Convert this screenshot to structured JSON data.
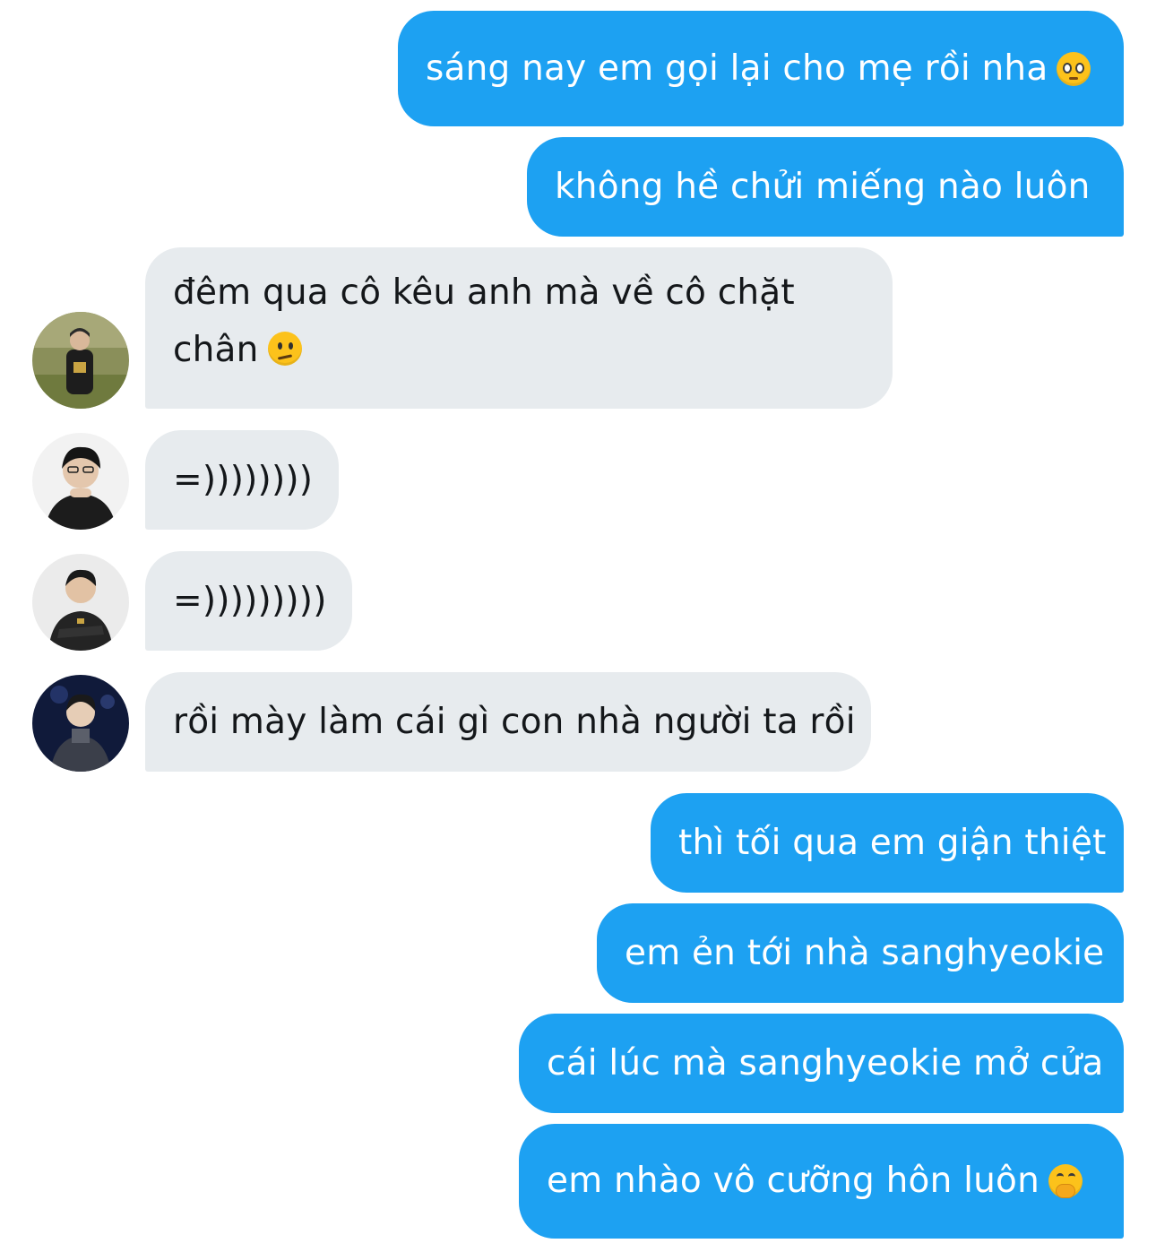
{
  "conversation": {
    "messages": [
      {
        "direction": "outgoing",
        "text": "sáng nay em gọi lại cho mẹ rồi nha",
        "emoji": "pleading-face-emoji"
      },
      {
        "direction": "outgoing",
        "text": "không hề chửi miếng nào luôn"
      },
      {
        "direction": "incoming",
        "text": "đêm qua cô kêu anh mà về cô chặt chân",
        "emoji": "confused-face-emoji",
        "avatar": "avatar-user-1"
      },
      {
        "direction": "incoming",
        "text": "=))))))))",
        "avatar": "avatar-user-2"
      },
      {
        "direction": "incoming",
        "text": "=)))))))))",
        "avatar": "avatar-user-3"
      },
      {
        "direction": "incoming",
        "text": "rồi mày làm cái gì con nhà người ta rồi",
        "avatar": "avatar-user-4"
      },
      {
        "direction": "outgoing",
        "text": "thì tối qua em giận thiệt"
      },
      {
        "direction": "outgoing",
        "text": "em ẻn tới nhà sanghyeokie"
      },
      {
        "direction": "outgoing",
        "text": "cái lúc mà sanghyeokie mở cửa"
      },
      {
        "direction": "outgoing",
        "text": "em nhào vô cưỡng hôn luôn",
        "emoji": "face-with-hand-over-mouth-emoji"
      }
    ]
  },
  "colors": {
    "outgoing_bubble": "#1da1f2",
    "incoming_bubble": "#e7ebee",
    "incoming_text": "#14171a",
    "outgoing_text": "#ffffff"
  }
}
